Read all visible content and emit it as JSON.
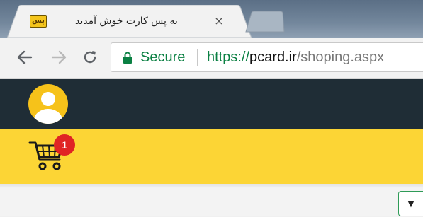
{
  "browser": {
    "tab": {
      "title": "به پس کارت خوش آمدید",
      "favicon_label": "پس",
      "close_glyph": "×"
    },
    "toolbar": {
      "back_icon": "arrow-left-icon",
      "forward_icon": "arrow-right-icon",
      "reload_icon": "reload-icon"
    },
    "omnibox": {
      "security_label": "Secure",
      "url_scheme": "https://",
      "url_host": "pcard.ir",
      "url_path": "/shoping.aspx"
    }
  },
  "site": {
    "header": {
      "avatar_icon": "user-avatar-icon"
    },
    "cart": {
      "icon": "shopping-cart-icon",
      "badge_count": "1"
    },
    "select": {
      "arrow_glyph": "▼"
    }
  },
  "colors": {
    "header_bg": "#1f2d36",
    "cart_bar_bg": "#fcd535",
    "badge_bg": "#e02424",
    "secure_green": "#0b8043"
  }
}
